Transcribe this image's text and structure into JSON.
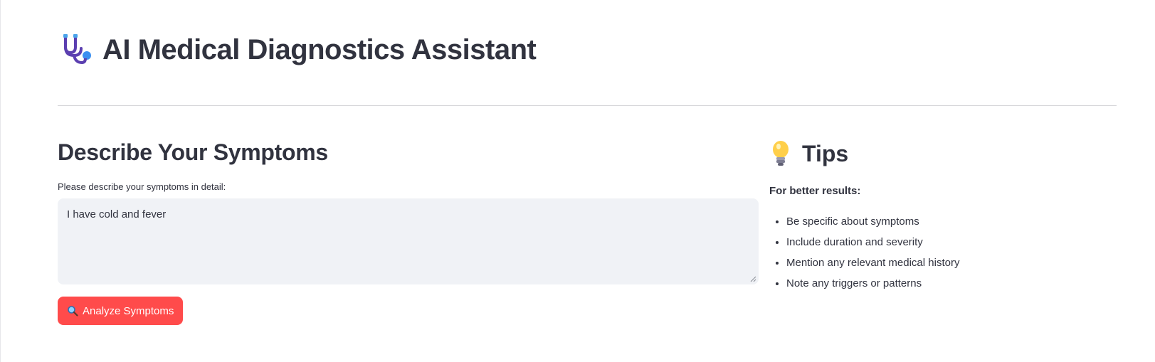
{
  "header": {
    "title": "AI Medical Diagnostics Assistant",
    "icon": "stethoscope-icon"
  },
  "symptoms": {
    "title": "Describe Your Symptoms",
    "label": "Please describe your symptoms in detail:",
    "value": "I have cold and fever",
    "button_label": "Analyze Symptoms",
    "button_icon": "magnifier-icon",
    "button_color": "#ff4b4b"
  },
  "tips": {
    "icon": "lightbulb-icon",
    "title": "Tips",
    "subtitle": "For better results:",
    "items": [
      "Be specific about symptoms",
      "Include duration and severity",
      "Mention any relevant medical history",
      "Note any triggers or patterns"
    ]
  }
}
